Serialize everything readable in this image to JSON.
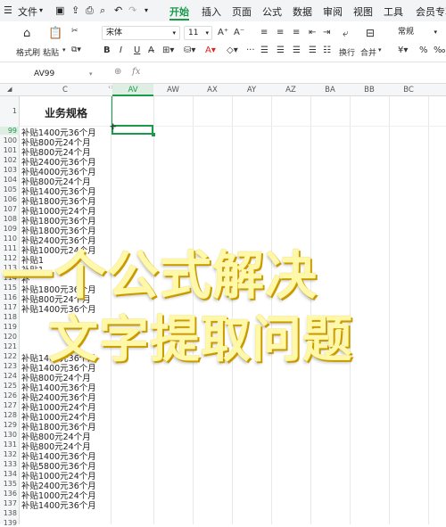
{
  "menubar": {
    "items": [
      "文件",
      "开始",
      "插入",
      "页面",
      "公式",
      "数据",
      "审阅",
      "视图",
      "工具",
      "会员专享"
    ],
    "active": "开始"
  },
  "ribbon": {
    "format_painter": "格式刷",
    "paste": "粘贴",
    "font_name": "宋体",
    "font_size": "11",
    "wrap": "换行",
    "merge": "合并",
    "number_format": "常规",
    "percent": "%",
    "comma": "‰"
  },
  "formula_bar": {
    "cell_ref": "AV99",
    "fx": "fx"
  },
  "columns": [
    "C",
    "AV",
    "AW",
    "AX",
    "AY",
    "AZ",
    "BA",
    "BB",
    "BC"
  ],
  "header_row": {
    "row": "1",
    "title": "业务规格"
  },
  "rows": [
    {
      "n": "99",
      "v": "补贴1400元36个月"
    },
    {
      "n": "100",
      "v": "补贴800元24个月"
    },
    {
      "n": "101",
      "v": "补贴800元24个月"
    },
    {
      "n": "102",
      "v": "补贴2400元36个月"
    },
    {
      "n": "103",
      "v": "补贴4000元36个月"
    },
    {
      "n": "104",
      "v": "补贴800元24个月"
    },
    {
      "n": "105",
      "v": "补贴1400元36个月"
    },
    {
      "n": "106",
      "v": "补贴1800元36个月"
    },
    {
      "n": "107",
      "v": "补贴1000元24个月"
    },
    {
      "n": "108",
      "v": "补贴1800元36个月"
    },
    {
      "n": "109",
      "v": "补贴1800元36个月"
    },
    {
      "n": "110",
      "v": "补贴2400元36个月"
    },
    {
      "n": "111",
      "v": "补贴1000元24个月"
    },
    {
      "n": "112",
      "v": "补贴1"
    },
    {
      "n": "113",
      "v": "补贴1"
    },
    {
      "n": "114",
      "v": "补"
    },
    {
      "n": "115",
      "v": "补贴1800元36个月"
    },
    {
      "n": "116",
      "v": "补贴800元24个月"
    },
    {
      "n": "117",
      "v": "补贴1400元36个月"
    },
    {
      "n": "118",
      "v": ""
    },
    {
      "n": "119",
      "v": ""
    },
    {
      "n": "120",
      "v": ""
    },
    {
      "n": "121",
      "v": ""
    },
    {
      "n": "122",
      "v": "补贴1400元36个月"
    },
    {
      "n": "123",
      "v": "补贴1400元36个月"
    },
    {
      "n": "124",
      "v": "补贴800元24个月"
    },
    {
      "n": "125",
      "v": "补贴1400元36个月"
    },
    {
      "n": "126",
      "v": "补贴2400元36个月"
    },
    {
      "n": "127",
      "v": "补贴1000元24个月"
    },
    {
      "n": "128",
      "v": "补贴1000元24个月"
    },
    {
      "n": "129",
      "v": "补贴1800元36个月"
    },
    {
      "n": "130",
      "v": "补贴800元24个月"
    },
    {
      "n": "131",
      "v": "补贴800元24个月"
    },
    {
      "n": "132",
      "v": "补贴1400元36个月"
    },
    {
      "n": "133",
      "v": "补贴5800元36个月"
    },
    {
      "n": "134",
      "v": "补贴1000元24个月"
    },
    {
      "n": "135",
      "v": "补贴2400元36个月"
    },
    {
      "n": "136",
      "v": "补贴1000元24个月"
    },
    {
      "n": "137",
      "v": "补贴1400元36个月"
    },
    {
      "n": "138",
      "v": ""
    },
    {
      "n": "139",
      "v": ""
    }
  ],
  "overlay": {
    "line1": "一个公式解决",
    "line2": "文字提取问题"
  },
  "colors": {
    "accent": "#1a9a4a",
    "overlay_text": "#fff8a8"
  }
}
